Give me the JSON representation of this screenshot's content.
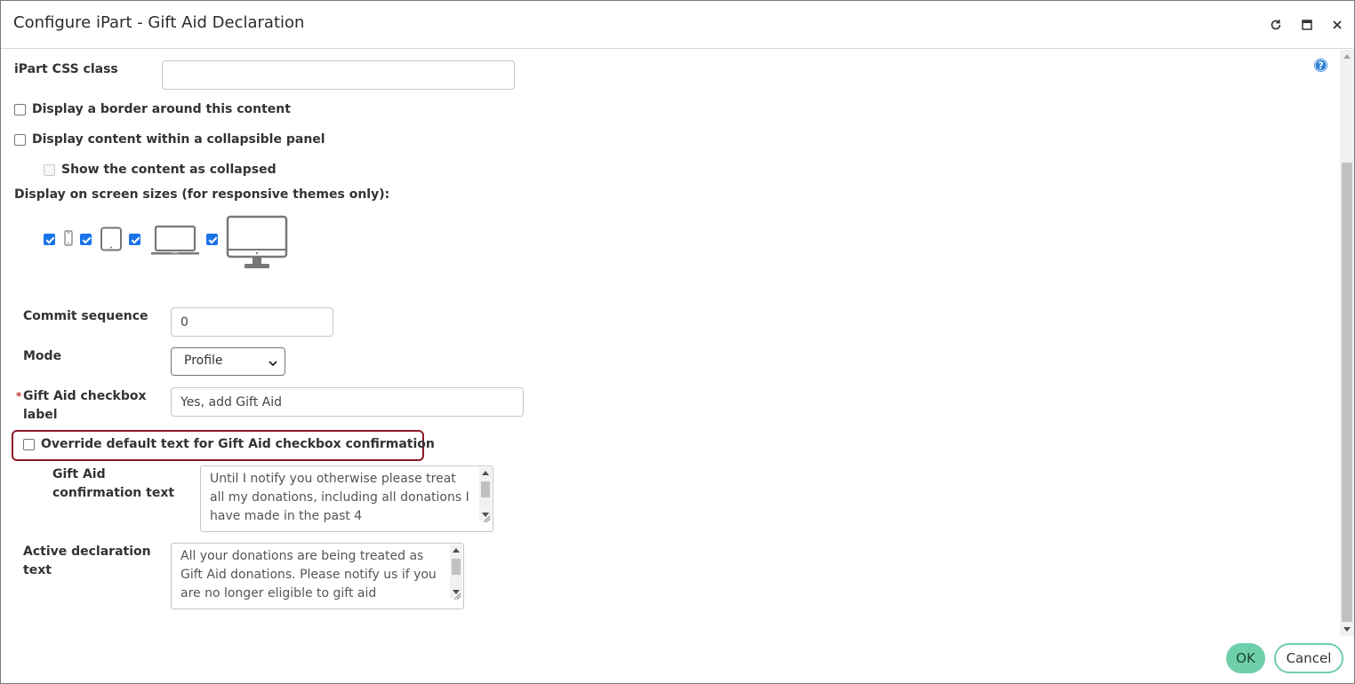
{
  "dialog": {
    "title": "Configure iPart - Gift Aid Declaration",
    "controls": [
      "refresh-icon",
      "maximize-icon",
      "close-icon"
    ]
  },
  "help_icon": "question-mark-circle-icon",
  "css_class": {
    "label": "iPart CSS class",
    "value": ""
  },
  "border_option": {
    "label": "Display a border around this content",
    "checked": false
  },
  "collapsible_option": {
    "label": "Display content within a collapsible panel",
    "checked": false
  },
  "collapsed_option": {
    "label": "Show the content as collapsed",
    "checked": false,
    "disabled": true
  },
  "screen_sizes": {
    "label": "Display on screen sizes (for responsive themes only):",
    "devices": [
      {
        "name": "phone",
        "checked": true
      },
      {
        "name": "tablet",
        "checked": true
      },
      {
        "name": "laptop",
        "checked": true
      },
      {
        "name": "desktop",
        "checked": true
      }
    ]
  },
  "commit_sequence": {
    "label": "Commit sequence",
    "value": "0"
  },
  "mode": {
    "label": "Mode",
    "value": "Profile"
  },
  "gift_aid_label": {
    "required_marker": "*",
    "label": "Gift Aid checkbox label",
    "value": "Yes, add Gift Aid"
  },
  "override_option": {
    "label": "Override default text for Gift Aid checkbox confirmation",
    "checked": false
  },
  "confirmation_text": {
    "label": "Gift Aid confirmation text",
    "value": "Until I notify you otherwise please treat all my donations, including all donations I have made in the past 4"
  },
  "active_declaration": {
    "label": "Active declaration text",
    "value": "All your donations are being treated as Gift Aid donations. Please notify us if you are no longer eligible to gift aid"
  },
  "buttons": {
    "ok": "OK",
    "cancel": "Cancel"
  },
  "colors": {
    "accent": "#6fcfab",
    "checkbox": "#1a73e8",
    "highlight": "#8b1a24"
  }
}
